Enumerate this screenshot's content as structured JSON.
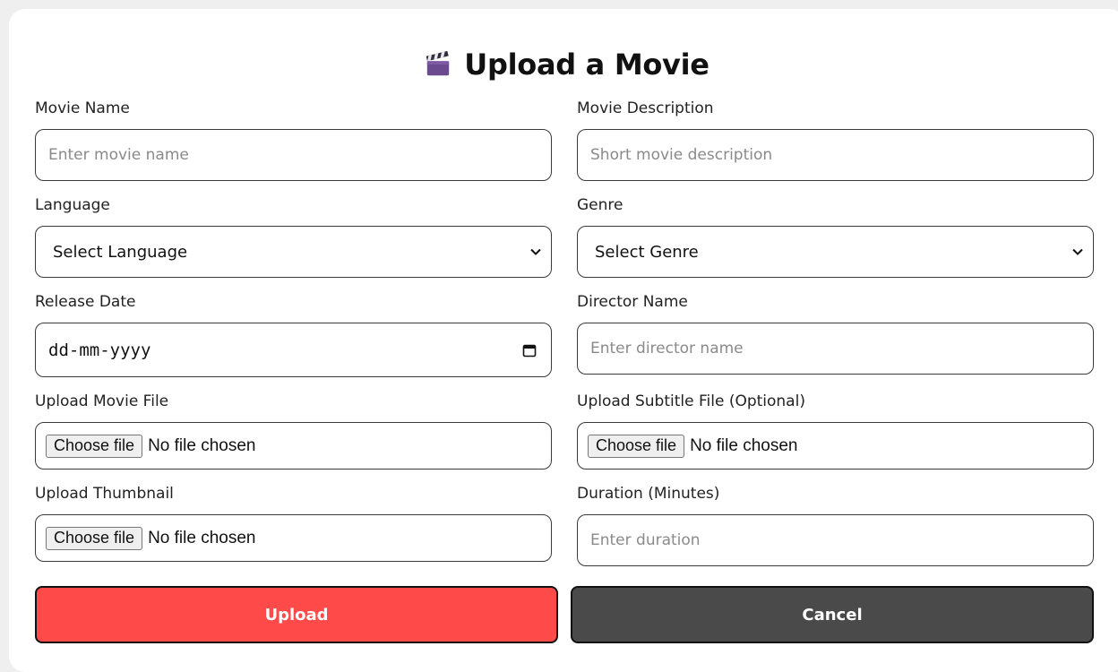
{
  "header": {
    "title": "Upload a Movie",
    "icon": "clapperboard-icon"
  },
  "form": {
    "movie_name": {
      "label": "Movie Name",
      "placeholder": "Enter movie name"
    },
    "movie_description": {
      "label": "Movie Description",
      "placeholder": "Short movie description"
    },
    "language": {
      "label": "Language",
      "selected": "Select Language"
    },
    "genre": {
      "label": "Genre",
      "selected": "Select Genre"
    },
    "release_date": {
      "label": "Release Date",
      "value": "dd-mm-yyyy"
    },
    "director_name": {
      "label": "Director Name",
      "placeholder": "Enter director name"
    },
    "movie_file": {
      "label": "Upload Movie File",
      "button": "Choose file",
      "status": "No file chosen"
    },
    "subtitle_file": {
      "label": "Upload Subtitle File (Optional)",
      "button": "Choose file",
      "status": "No file chosen"
    },
    "thumbnail": {
      "label": "Upload Thumbnail",
      "button": "Choose file",
      "status": "No file chosen"
    },
    "duration": {
      "label": "Duration (Minutes)",
      "placeholder": "Enter duration"
    }
  },
  "actions": {
    "upload": "Upload",
    "cancel": "Cancel"
  },
  "colors": {
    "upload": "#ff4a4a",
    "cancel": "#4a4a4a",
    "border": "#3a3a3a"
  }
}
